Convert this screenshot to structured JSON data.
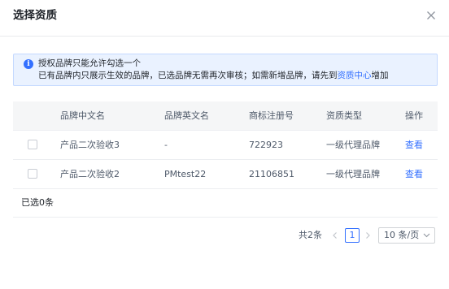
{
  "modal": {
    "title": "选择资质",
    "close_icon": "close-icon"
  },
  "alert": {
    "icon": "info-icon",
    "line1": "授权品牌只能允许勾选一个",
    "line2_prefix": "已有品牌内只展示生效的品牌，已选品牌无需再次审核；如需新增品牌，请先到",
    "line2_link": "资质中心",
    "line2_suffix": "增加"
  },
  "table": {
    "columns": [
      "品牌中文名",
      "品牌英文名",
      "商标注册号",
      "资质类型",
      "操作"
    ],
    "rows": [
      {
        "checked": false,
        "cn_name": "产品二次验收3",
        "en_name": "-",
        "reg_no": "722923",
        "type": "一级代理品牌",
        "action": "查看"
      },
      {
        "checked": false,
        "cn_name": "产品二次验收2",
        "en_name": "PMtest22",
        "reg_no": "21106851",
        "type": "一级代理品牌",
        "action": "查看"
      }
    ],
    "selected_text": "已选0条"
  },
  "pagination": {
    "total_text": "共2条",
    "current_page": "1",
    "page_size": "10 条/页",
    "prev_icon": "chevron-left-icon",
    "next_icon": "chevron-right-icon",
    "dropdown_icon": "chevron-down-icon"
  },
  "colors": {
    "primary": "#3370ff",
    "alert_bg": "#eaf2ff",
    "alert_border": "#c3d8ff",
    "header_bg": "#f5f6f7"
  }
}
